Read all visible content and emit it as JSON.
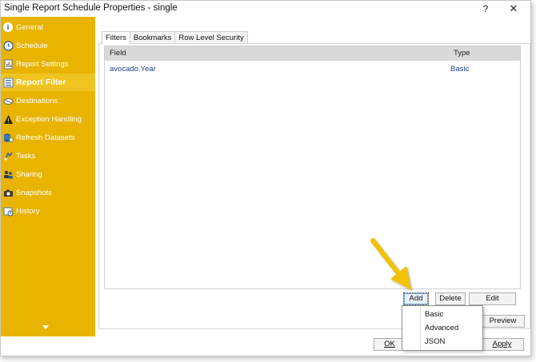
{
  "window": {
    "title": "Single Report Schedule Properties - single",
    "help_label": "?",
    "close_label": "✕"
  },
  "sidebar": {
    "items": [
      {
        "label": "General",
        "icon": "info-icon"
      },
      {
        "label": "Schedule",
        "icon": "clock-icon"
      },
      {
        "label": "Report Settings",
        "icon": "report-settings-icon"
      },
      {
        "label": "Report Filter",
        "icon": "report-filter-icon",
        "active": true
      },
      {
        "label": "Destinations",
        "icon": "destinations-icon"
      },
      {
        "label": "Exception Handling",
        "icon": "warning-icon"
      },
      {
        "label": "Refresh Datasets",
        "icon": "refresh-icon"
      },
      {
        "label": "Tasks",
        "icon": "tasks-icon"
      },
      {
        "label": "Sharing",
        "icon": "sharing-icon"
      },
      {
        "label": "Snapshots",
        "icon": "snapshots-icon"
      },
      {
        "label": "History",
        "icon": "history-icon"
      }
    ],
    "accent": "#e8b400"
  },
  "tabs": {
    "filters": "Filters",
    "bookmarks": "Bookmarks",
    "row_level_security": "Row Level Security"
  },
  "grid": {
    "columns": {
      "field": "Field",
      "type": "Type"
    },
    "rows": [
      {
        "field": "avocado.Year",
        "type": "Basic"
      }
    ]
  },
  "buttons": {
    "add": "Add",
    "delete": "Delete",
    "edit": "Edit",
    "preview": "Preview",
    "ok": "OK",
    "apply": "Apply"
  },
  "dropdown": {
    "items": [
      "Basic",
      "Advanced",
      "JSON"
    ]
  }
}
